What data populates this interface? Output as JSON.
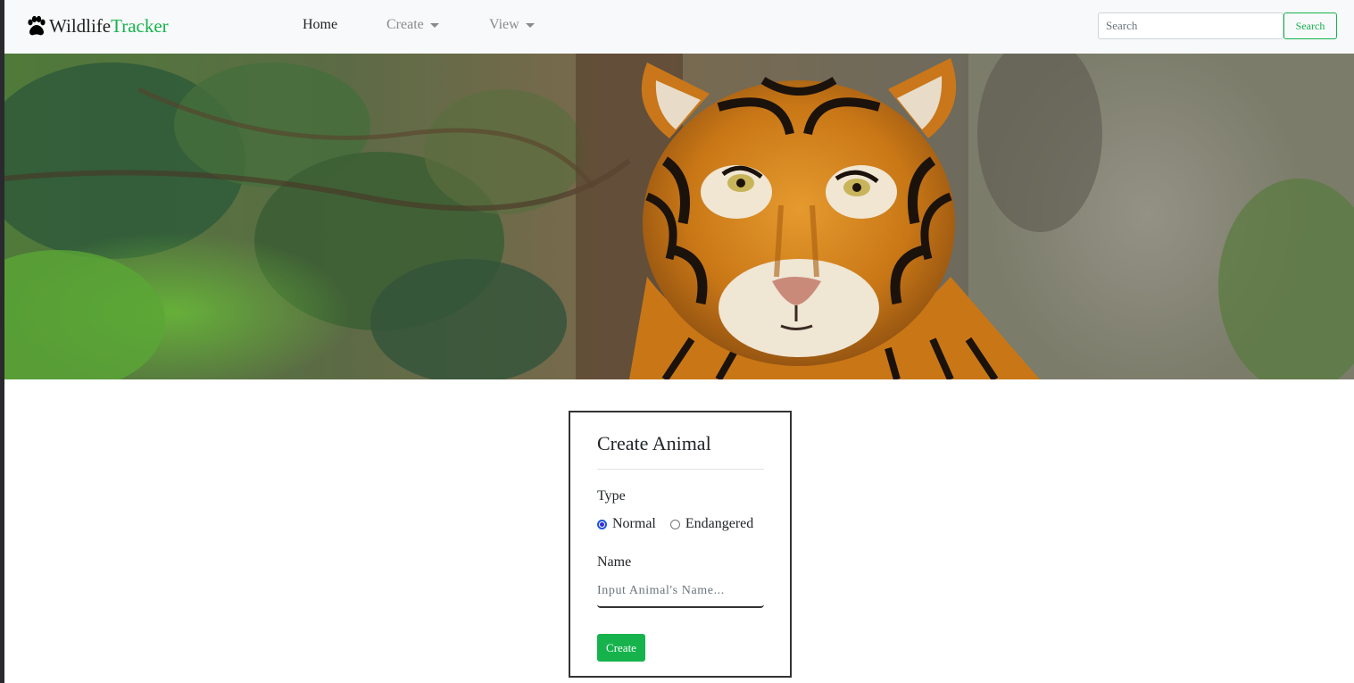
{
  "brand": {
    "word1": "Wildlife",
    "word2": "Tracker",
    "icon": "paw-icon",
    "color": "#16b34d"
  },
  "nav": {
    "home": "Home",
    "create": "Create",
    "view": "View"
  },
  "search": {
    "placeholder": "Search",
    "button": "Search"
  },
  "hero": {
    "image": "tiger-photo"
  },
  "form": {
    "title": "Create Animal",
    "type_label": "Type",
    "options": [
      "Normal",
      "Endangered"
    ],
    "selected": "Normal",
    "name_label": "Name",
    "name_placeholder": "Input Animal's Name...",
    "submit": "Create"
  }
}
